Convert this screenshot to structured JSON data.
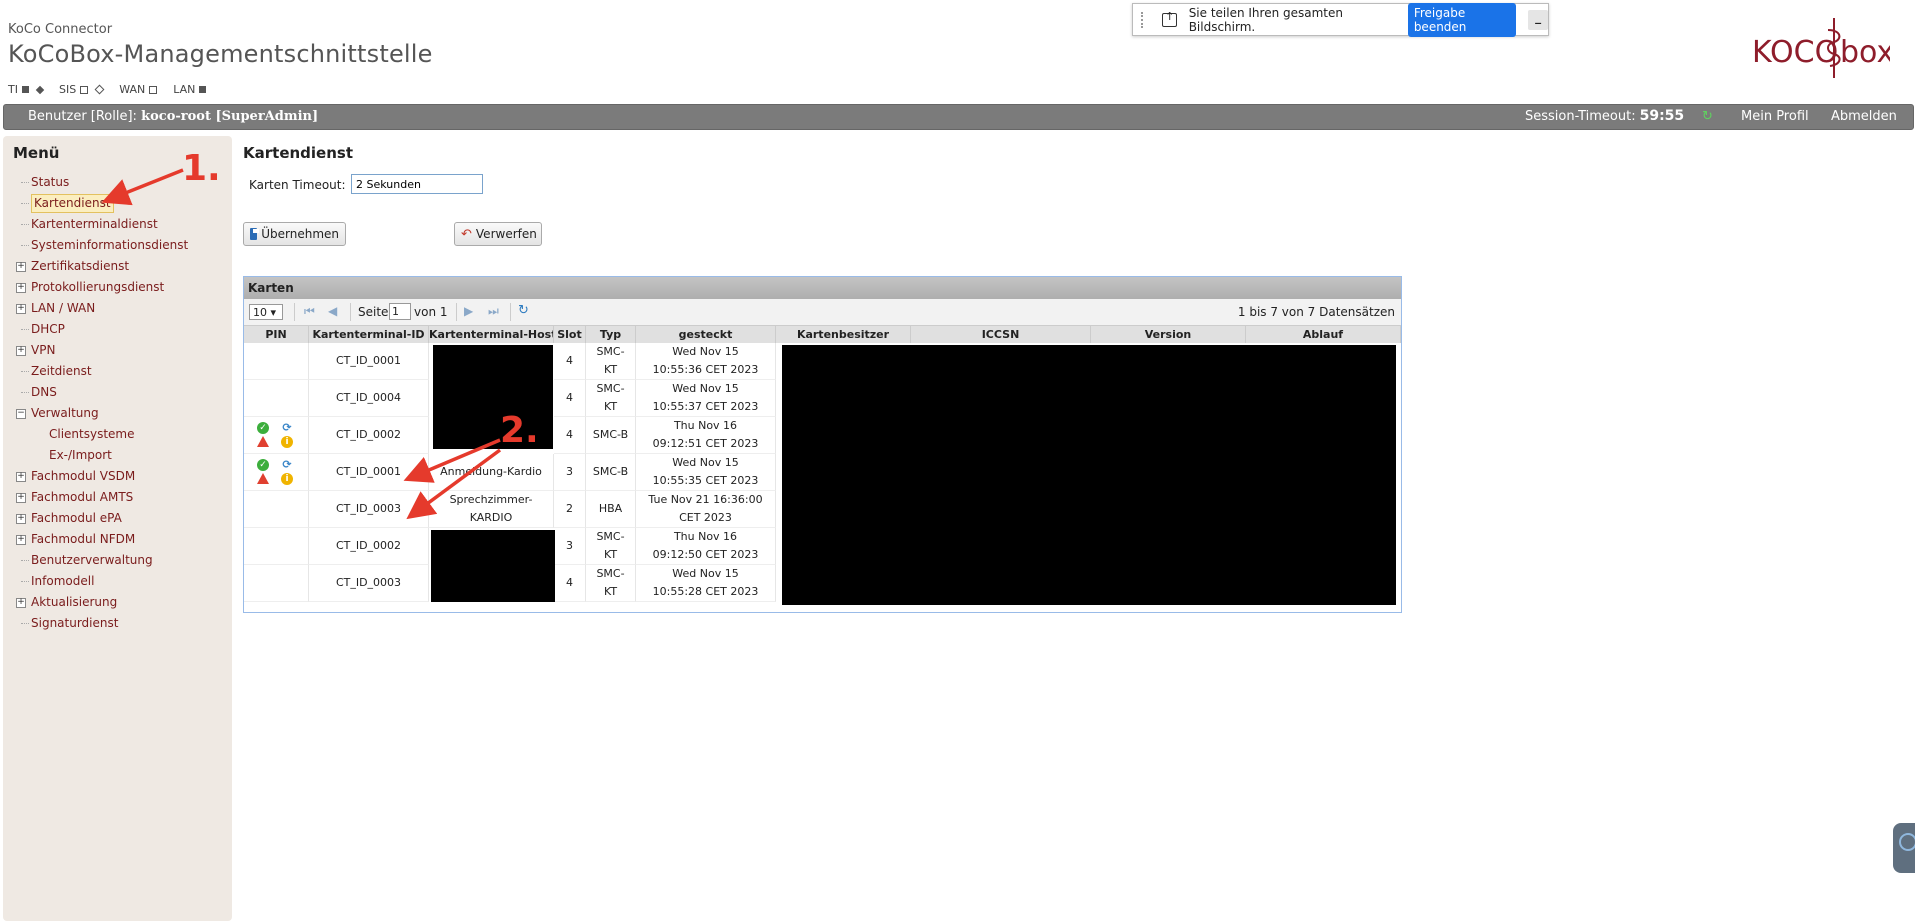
{
  "app": {
    "subtitle": "KoCo Connector",
    "title": "KoCoBox-Managementschnittstelle",
    "status": [
      {
        "label": "TI",
        "square": "filled",
        "diamond": "filled"
      },
      {
        "label": "SIS",
        "square": "empty",
        "diamond": "empty"
      },
      {
        "label": "WAN",
        "square": "empty"
      },
      {
        "label": "LAN",
        "square": "filled"
      }
    ]
  },
  "share_bar": {
    "text": "Sie teilen Ihren gesamten Bildschirm.",
    "button": "Freigabe beenden",
    "minimize": "_"
  },
  "logo": {
    "left": "KOCO",
    "right": "box"
  },
  "topbar": {
    "user_label": "Benutzer [Rolle]:",
    "user_value": "koco-root [SuperAdmin]",
    "session_label": "Session-Timeout:",
    "session_value": "59:55",
    "profile": "Mein Profil",
    "logout": "Abmelden"
  },
  "menu": {
    "title": "Menü",
    "items": [
      {
        "label": "Status",
        "expandable": false
      },
      {
        "label": "Kartendienst",
        "expandable": false,
        "active": true
      },
      {
        "label": "Kartenterminaldienst",
        "expandable": false
      },
      {
        "label": "Systeminformationsdienst",
        "expandable": false
      },
      {
        "label": "Zertifikatsdienst",
        "expandable": true
      },
      {
        "label": "Protokollierungsdienst",
        "expandable": true
      },
      {
        "label": "LAN / WAN",
        "expandable": true
      },
      {
        "label": "DHCP",
        "expandable": false
      },
      {
        "label": "VPN",
        "expandable": true
      },
      {
        "label": "Zeitdienst",
        "expandable": false
      },
      {
        "label": "DNS",
        "expandable": false
      },
      {
        "label": "Verwaltung",
        "expandable": true,
        "expanded": true
      },
      {
        "label": "Clientsysteme",
        "sub": true
      },
      {
        "label": "Ex-/Import",
        "sub": true
      },
      {
        "label": "Fachmodul VSDM",
        "expandable": true
      },
      {
        "label": "Fachmodul AMTS",
        "expandable": true
      },
      {
        "label": "Fachmodul ePA",
        "expandable": true
      },
      {
        "label": "Fachmodul NFDM",
        "expandable": true
      },
      {
        "label": "Benutzerverwaltung",
        "expandable": false
      },
      {
        "label": "Infomodell",
        "expandable": false
      },
      {
        "label": "Aktualisierung",
        "expandable": true
      },
      {
        "label": "Signaturdienst",
        "expandable": false
      }
    ]
  },
  "content": {
    "title": "Kartendienst",
    "timeout_label": "Karten Timeout:",
    "timeout_value": "2 Sekunden",
    "apply_button": "Übernehmen",
    "discard_button": "Verwerfen"
  },
  "grid": {
    "title": "Karten",
    "page_size": "10",
    "page_label": "Seite",
    "page_value": "1",
    "page_of": "von 1",
    "record_count": "1 bis 7 von 7 Datensätzen",
    "columns": [
      "PIN",
      "Kartenterminal-ID",
      "Kartenterminal-Hostname",
      "Slot",
      "Typ",
      "gesteckt",
      "Kartenbesitzer",
      "ICCSN",
      "Version",
      "Ablauf"
    ],
    "rows": [
      {
        "pin": false,
        "terminal_id": "CT_ID_0001",
        "hostname": "",
        "slot": "4",
        "type": "SMC-KT",
        "inserted": "Wed Nov 15 10:55:36 CET 2023"
      },
      {
        "pin": false,
        "terminal_id": "CT_ID_0004",
        "hostname": "",
        "slot": "4",
        "type": "SMC-KT",
        "inserted": "Wed Nov 15 10:55:37 CET 2023"
      },
      {
        "pin": true,
        "terminal_id": "CT_ID_0002",
        "hostname": "",
        "slot": "4",
        "type": "SMC-B",
        "inserted": "Thu Nov 16 09:12:51 CET 2023"
      },
      {
        "pin": true,
        "terminal_id": "CT_ID_0001",
        "hostname": "Anmeldung-Kardio",
        "slot": "3",
        "type": "SMC-B",
        "inserted": "Wed Nov 15 10:55:35 CET 2023"
      },
      {
        "pin": false,
        "terminal_id": "CT_ID_0003",
        "hostname": "Sprechzimmer-KARDIO",
        "slot": "2",
        "type": "HBA",
        "inserted": "Tue Nov 21 16:36:00 CET 2023"
      },
      {
        "pin": false,
        "terminal_id": "CT_ID_0002",
        "hostname": "",
        "slot": "3",
        "type": "SMC-KT",
        "inserted": "Thu Nov 16 09:12:50 CET 2023"
      },
      {
        "pin": false,
        "terminal_id": "CT_ID_0003",
        "hostname": "",
        "slot": "4",
        "type": "SMC-KT",
        "inserted": "Wed Nov 15 10:55:28 CET 2023"
      }
    ]
  },
  "annotations": {
    "label_1": "1.",
    "label_2": "2."
  },
  "colors": {
    "accent": "#7a1c1c",
    "topbar": "#7b7b7b",
    "arrow": "#e53a2c",
    "share_button": "#1a73e8"
  }
}
